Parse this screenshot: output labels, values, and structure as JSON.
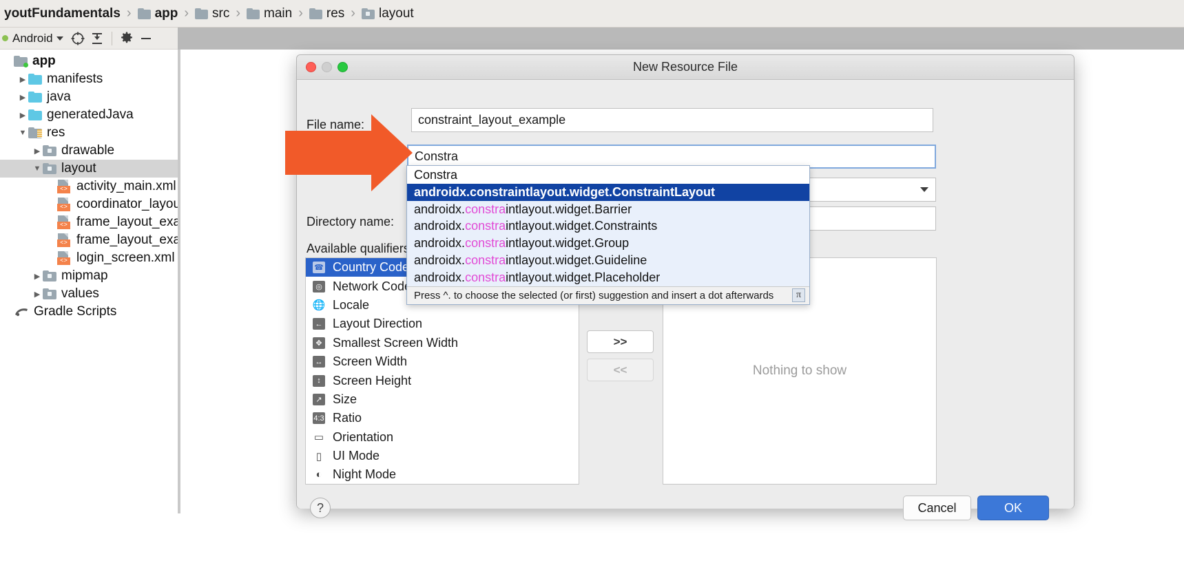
{
  "breadcrumb": {
    "items": [
      {
        "label": "youtFundamentals",
        "icon": "none",
        "bold": true
      },
      {
        "label": "app",
        "icon": "folder-green-dot",
        "bold": true
      },
      {
        "label": "src",
        "icon": "folder",
        "bold": false
      },
      {
        "label": "main",
        "icon": "folder",
        "bold": false
      },
      {
        "label": "res",
        "icon": "folder-res",
        "bold": false
      },
      {
        "label": "layout",
        "icon": "folder-open",
        "bold": false
      }
    ],
    "separator": "›"
  },
  "project_toolbar": {
    "title": "Android",
    "dropdown_icon": "chevron-down-icon",
    "icons": [
      "target-icon",
      "collapse-all-icon",
      "settings-gear-icon",
      "minimize-icon"
    ]
  },
  "tree": {
    "nodes": [
      {
        "label": "app",
        "depth": 0,
        "arrow": "none",
        "icon": "folder-module",
        "bold": true,
        "selected": false
      },
      {
        "label": "manifests",
        "depth": 1,
        "arrow": "right",
        "icon": "folder-blue",
        "bold": false,
        "selected": false
      },
      {
        "label": "java",
        "depth": 1,
        "arrow": "right",
        "icon": "folder-blue",
        "bold": false,
        "selected": false
      },
      {
        "label": "generatedJava",
        "depth": 1,
        "arrow": "right",
        "icon": "folder-generated",
        "bold": false,
        "selected": false
      },
      {
        "label": "res",
        "depth": 1,
        "arrow": "down",
        "icon": "folder-res",
        "bold": false,
        "selected": false
      },
      {
        "label": "drawable",
        "depth": 2,
        "arrow": "right",
        "icon": "folder-gray",
        "bold": false,
        "selected": false
      },
      {
        "label": "layout",
        "depth": 2,
        "arrow": "down",
        "icon": "folder-gray",
        "bold": false,
        "selected": true
      },
      {
        "label": "activity_main.xml",
        "depth": 3,
        "arrow": "none",
        "icon": "xml-file",
        "bold": false,
        "selected": false
      },
      {
        "label": "coordinator_layout",
        "depth": 3,
        "arrow": "none",
        "icon": "xml-file",
        "bold": false,
        "selected": false
      },
      {
        "label": "frame_layout_exam",
        "depth": 3,
        "arrow": "none",
        "icon": "xml-file",
        "bold": false,
        "selected": false
      },
      {
        "label": "frame_layout_exam",
        "depth": 3,
        "arrow": "none",
        "icon": "xml-file",
        "bold": false,
        "selected": false
      },
      {
        "label": "login_screen.xml",
        "depth": 3,
        "arrow": "none",
        "icon": "xml-file",
        "bold": false,
        "selected": false
      },
      {
        "label": "mipmap",
        "depth": 2,
        "arrow": "right",
        "icon": "folder-gray",
        "bold": false,
        "selected": false
      },
      {
        "label": "values",
        "depth": 2,
        "arrow": "right",
        "icon": "folder-gray",
        "bold": false,
        "selected": false
      },
      {
        "label": "Gradle Scripts",
        "depth": 0,
        "arrow": "none",
        "icon": "gradle-icon",
        "bold": false,
        "selected": false
      }
    ]
  },
  "dialog": {
    "title": "New Resource File",
    "window_controls": [
      "close-red",
      "minimize-yellow",
      "zoom-green"
    ],
    "file_name_label": "File name:",
    "file_name_value": "constraint_layout_example",
    "root_element_value": "Constra",
    "directory_name_label": "Directory name:",
    "directory_name_value": "",
    "available_qualifiers_label": "Available qualifiers:",
    "qualifiers": [
      {
        "label": "Country Code",
        "icon": "country-code-icon",
        "selected": true
      },
      {
        "label": "Network Code",
        "icon": "network-code-icon",
        "selected": false
      },
      {
        "label": "Locale",
        "icon": "locale-globe-icon",
        "selected": false
      },
      {
        "label": "Layout Direction",
        "icon": "layout-direction-icon",
        "selected": false
      },
      {
        "label": "Smallest Screen Width",
        "icon": "smallest-screen-width-icon",
        "selected": false
      },
      {
        "label": "Screen Width",
        "icon": "screen-width-icon",
        "selected": false
      },
      {
        "label": "Screen Height",
        "icon": "screen-height-icon",
        "selected": false
      },
      {
        "label": "Size",
        "icon": "size-icon",
        "selected": false
      },
      {
        "label": "Ratio",
        "icon": "ratio-icon",
        "selected": false
      },
      {
        "label": "Orientation",
        "icon": "orientation-icon",
        "selected": false
      },
      {
        "label": "UI Mode",
        "icon": "ui-mode-icon",
        "selected": false
      },
      {
        "label": "Night Mode",
        "icon": "night-mode-icon",
        "selected": false
      }
    ],
    "add_button_label": ">>",
    "remove_button_label": "<<",
    "chosen_empty_text": "Nothing to show",
    "help_button_label": "?",
    "cancel_button_label": "Cancel",
    "ok_button_label": "OK"
  },
  "autocomplete": {
    "query": "Constra",
    "match_fragment": "constra",
    "items": [
      {
        "prefix": "androidx.",
        "match": "constra",
        "suffix": "intlayout.widget.ConstraintLayout",
        "selected": true
      },
      {
        "prefix": "androidx.",
        "match": "constra",
        "suffix": "intlayout.widget.Barrier",
        "selected": false
      },
      {
        "prefix": "androidx.",
        "match": "constra",
        "suffix": "intlayout.widget.Constraints",
        "selected": false
      },
      {
        "prefix": "androidx.",
        "match": "constra",
        "suffix": "intlayout.widget.Group",
        "selected": false
      },
      {
        "prefix": "androidx.",
        "match": "constra",
        "suffix": "intlayout.widget.Guideline",
        "selected": false
      },
      {
        "prefix": "androidx.",
        "match": "constra",
        "suffix": "intlayout.widget.Placeholder",
        "selected": false
      }
    ],
    "hint": "Press ^. to choose the selected (or first) suggestion and insert a dot afterwards",
    "hint_badge": "π"
  },
  "annotation": {
    "arrow_color": "#f15a29",
    "arrow_name": "orange-pointer-arrow"
  },
  "colors": {
    "selection_blue": "#1143a3",
    "qualifier_selection": "#2a62c9",
    "ok_button": "#3c78d8",
    "match_magenta": "#e24bd6",
    "accent_orange": "#f15a29"
  }
}
